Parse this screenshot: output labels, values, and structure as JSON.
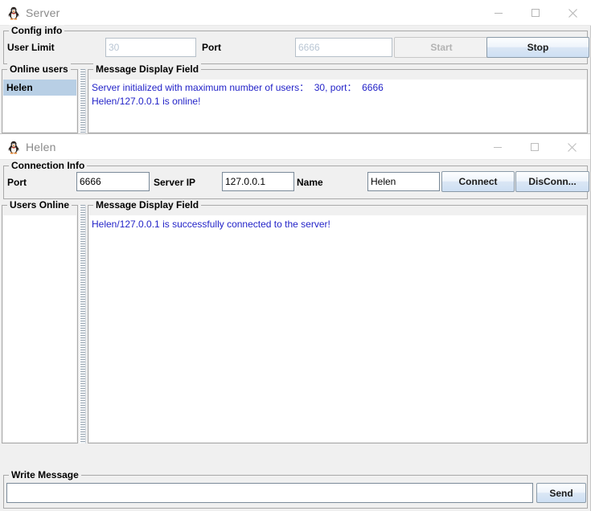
{
  "server_window": {
    "title": "Server",
    "icon": "penguin-app-icon",
    "controls": {
      "minimize": "minimize-icon",
      "maximize": "maximize-icon",
      "close": "close-icon"
    },
    "config_group": {
      "title": "Config info",
      "user_limit_label": "User Limit",
      "user_limit_value": "30",
      "port_label": "Port",
      "port_value": "6666",
      "start_button": "Start",
      "stop_button": "Stop"
    },
    "online_users": {
      "title": "Online users",
      "items": [
        "Helen"
      ]
    },
    "message_display": {
      "title": "Message Display Field",
      "lines": [
        "Server initialized with maximum number of users：  30, port：  6666",
        "Helen/127.0.0.1 is online!"
      ]
    }
  },
  "client_window": {
    "title": "Helen",
    "icon": "penguin-app-icon",
    "controls": {
      "minimize": "minimize-icon",
      "maximize": "maximize-icon",
      "close": "close-icon"
    },
    "connection_group": {
      "title": "Connection Info",
      "port_label": "Port",
      "port_value": "6666",
      "server_ip_label": "Server IP",
      "server_ip_value": "127.0.0.1",
      "name_label": "Name",
      "name_value": "Helen",
      "connect_button": "Connect",
      "disconnect_button": "DisConn..."
    },
    "users_online": {
      "title": "Users Online",
      "items": []
    },
    "message_display": {
      "title": "Message Display Field",
      "lines": [
        "Helen/127.0.0.1 is successfully connected to the server!"
      ]
    },
    "write_message": {
      "title": "Write Message",
      "input_value": "",
      "send_button": "Send"
    }
  },
  "colors": {
    "message_text": "#2323c8",
    "window_bg": "#f0f0f0",
    "selection": "#b8cfe5",
    "button_accent": "#cddff3"
  }
}
